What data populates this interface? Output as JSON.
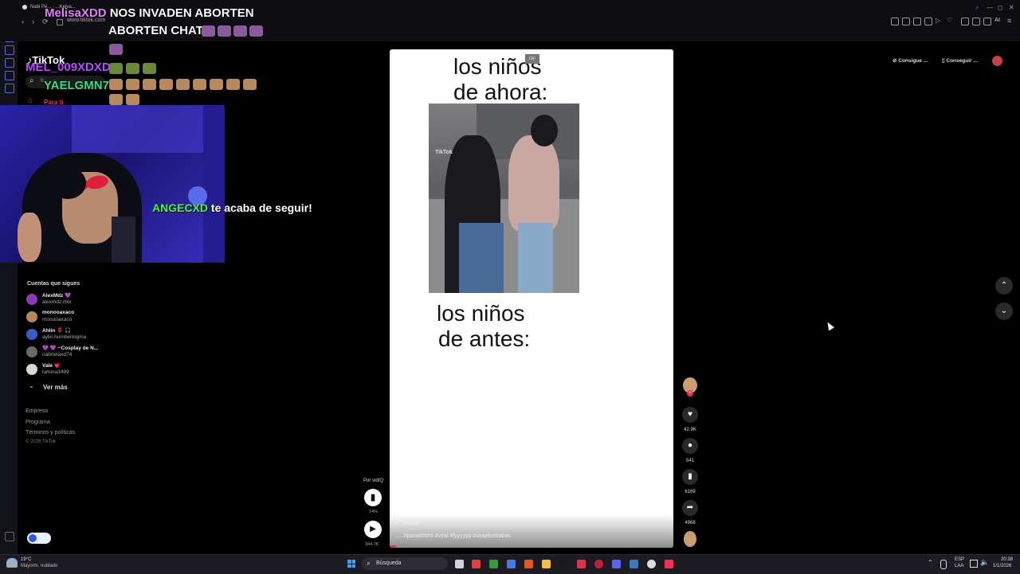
{
  "browser": {
    "tab_title": "Nabi Pe... · ...Kelva...",
    "url": "www.tiktok.com",
    "back": "‹",
    "forward": "›",
    "reload": "⟳",
    "toolbar_right_label": "AI",
    "window_controls": [
      "—",
      "◻",
      "✕"
    ]
  },
  "overlay": {
    "chat": [
      {
        "user": "MelisaXDD",
        "user_color": "#e87cff",
        "message_1": "NOS INVADEN ABORTEN",
        "message_2": "ABORTEN CHATT"
      },
      {
        "user": "MEL_009XDXD",
        "user_color": "#b44cff",
        "message_1": ""
      },
      {
        "user": "YAELGMN7",
        "user_color": "#33e08a",
        "message_1": ""
      }
    ],
    "follow_alert": {
      "user": "ANGECXD",
      "user_color": "#3cff3c",
      "text": "te acaba de seguir!"
    }
  },
  "tiktok": {
    "logo": "TikTok",
    "search_placeholder": "B",
    "nav_for_you": "Para ti",
    "following_header": "Cuentas que sigues",
    "accounts": [
      {
        "name": "AlexMdz 💜",
        "handle": "alexmdz.rblx",
        "color": "#8a3ab8"
      },
      {
        "name": "monooaxaco",
        "handle": "monooaxaco",
        "color": "#b08a5a"
      },
      {
        "name": "Ahlin 🌹 🎧",
        "handle": "aylin.humbertogma",
        "color": "#3a5ac8"
      },
      {
        "name": "💜 💜 ~Cosplay de N...",
        "handle": "nabrielaxd74",
        "color": "#6a6a6a"
      },
      {
        "name": "Vale 💗",
        "handle": "lumina3499",
        "color": "#d8d8d8"
      }
    ],
    "see_more": "Ver más",
    "footer": [
      "Empresa",
      "Programa",
      "Términos y políticas"
    ],
    "copyright": "© 2026 TikTok",
    "top_right_buttons": [
      "Consigue ...",
      "Conseguir ..."
    ],
    "video": {
      "text_top_1": "los niños",
      "text_top_2": "de ahora:",
      "text_bottom_1": "los niños",
      "text_bottom_2": "de antes:",
      "watermark": "TikTok",
      "small_badge": "GIF",
      "username": "lil_bit123",
      "caption": "......#parati#### #viral #fyyyyyp #viraelostrabas"
    },
    "actions": {
      "likes": "42.9K",
      "comments": "541",
      "saves": "6169",
      "shares": "4968"
    },
    "vidiq": {
      "label": "Por vidIQ",
      "percent": "14%",
      "views": "344.7K"
    }
  },
  "taskbar": {
    "weather_temp": "19°C",
    "weather_desc": "Mayorm. nublado",
    "search": "Búsqueda",
    "lang_1": "ESP",
    "lang_2": "LAA",
    "time": "20:38",
    "date": "1/1/2026"
  }
}
